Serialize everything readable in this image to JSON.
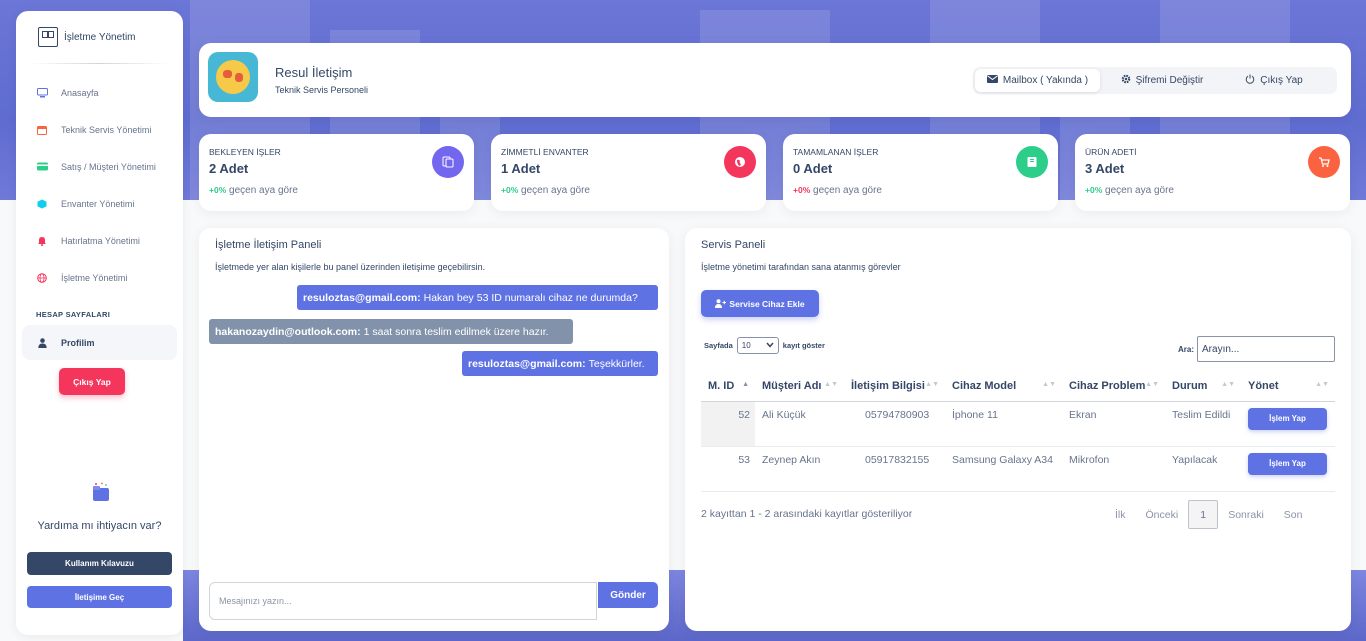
{
  "sidebar": {
    "brand": "İşletme Yönetim",
    "items": [
      {
        "label": "Anasayfa",
        "icon": "monitor-icon",
        "color": "#5e72e4"
      },
      {
        "label": "Teknik Servis Yönetimi",
        "icon": "calendar-icon",
        "color": "#fb6340"
      },
      {
        "label": "Satış / Müşteri Yönetimi",
        "icon": "credit-card-icon",
        "color": "#2dce89"
      },
      {
        "label": "Envanter Yönetimi",
        "icon": "box-icon",
        "color": "#11cdef"
      },
      {
        "label": "Hatırlatma Yönetimi",
        "icon": "bell-icon",
        "color": "#f5365c"
      },
      {
        "label": "İşletme Yönetimi",
        "icon": "globe-icon",
        "color": "#f5365c"
      }
    ],
    "section_label": "HESAP SAYFALARI",
    "profile_label": "Profilim",
    "logout_label": "Çıkış Yap",
    "help_title": "Yardıma mı ihtiyacın var?",
    "guide_label": "Kullanım Kılavuzu",
    "contact_label": "İletişime Geç"
  },
  "header": {
    "name": "Resul İletişim",
    "role": "Teknik Servis Personeli",
    "mailbox_label": "Mailbox ( Yakında )",
    "password_label": "Şifremi Değiştir",
    "logout_label": "Çıkış Yap"
  },
  "stats": [
    {
      "label": "BEKLEYEN İŞLER",
      "value": "2 Adet",
      "pct": "+0%",
      "pct_color": "#2dce89",
      "suffix": "geçen aya göre",
      "icon": "document-icon",
      "color": "#7367f0"
    },
    {
      "label": "ZİMMETLİ ENVANTER",
      "value": "1 Adet",
      "pct": "+0%",
      "pct_color": "#2dce89",
      "suffix": "geçen aya göre",
      "icon": "globe-icon",
      "color": "#f5365c"
    },
    {
      "label": "TAMAMLANAN İŞLER",
      "value": "0 Adet",
      "pct": "+0%",
      "pct_color": "#f5365c",
      "suffix": "geçen aya göre",
      "icon": "note-icon",
      "color": "#2dce89"
    },
    {
      "label": "ÜRÜN ADETİ",
      "value": "3 Adet",
      "pct": "+0%",
      "pct_color": "#2dce89",
      "suffix": "geçen aya göre",
      "icon": "cart-icon",
      "color": "#fb6340"
    }
  ],
  "chat": {
    "title": "İşletme İletişim Paneli",
    "subtitle": "İşletmede yer alan kişilerle bu panel üzerinden iletişime geçebilirsin.",
    "messages": [
      {
        "sender": "resuloztas@gmail.com:",
        "text": "Hakan bey 53 ID numaralı cihaz ne durumda?",
        "mine": true
      },
      {
        "sender": "hakanozaydin@outlook.com:",
        "text": "1 saat sonra teslim edilmek üzere hazır.",
        "mine": false
      },
      {
        "sender": "resuloztas@gmail.com:",
        "text": "Teşekkürler.",
        "mine": true
      }
    ],
    "input_placeholder": "Mesajınızı yazın...",
    "send_label": "Gönder"
  },
  "service": {
    "title": "Servis Paneli",
    "subtitle": "İşletme yönetimi tarafından sana atanmış görevler",
    "add_label": "Servise Cihaz Ekle",
    "len_prefix": "Sayfada",
    "len_value": "10",
    "len_suffix": "kayıt göster",
    "search_label": "Ara:",
    "search_placeholder": "Arayın...",
    "columns": [
      "M. ID",
      "Müşteri Adı",
      "İletişim Bilgisi",
      "Cihaz Model",
      "Cihaz Problem",
      "Durum",
      "Yönet"
    ],
    "rows": [
      {
        "id": "52",
        "customer": "Ali Küçük",
        "phone": "05794780903",
        "model": "İphone 11",
        "problem": "Ekran",
        "status": "Teslim Edildi",
        "action": "İşlem Yap"
      },
      {
        "id": "53",
        "customer": "Zeynep Akın",
        "phone": "05917832155",
        "model": "Samsung Galaxy A34",
        "problem": "Mikrofon",
        "status": "Yapılacak",
        "action": "İşlem Yap"
      }
    ],
    "info": "2 kayıttan 1 - 2 arasındaki kayıtlar gösteriliyor",
    "pager": {
      "first": "İlk",
      "prev": "Önceki",
      "current": "1",
      "next": "Sonraki",
      "last": "Son"
    }
  }
}
